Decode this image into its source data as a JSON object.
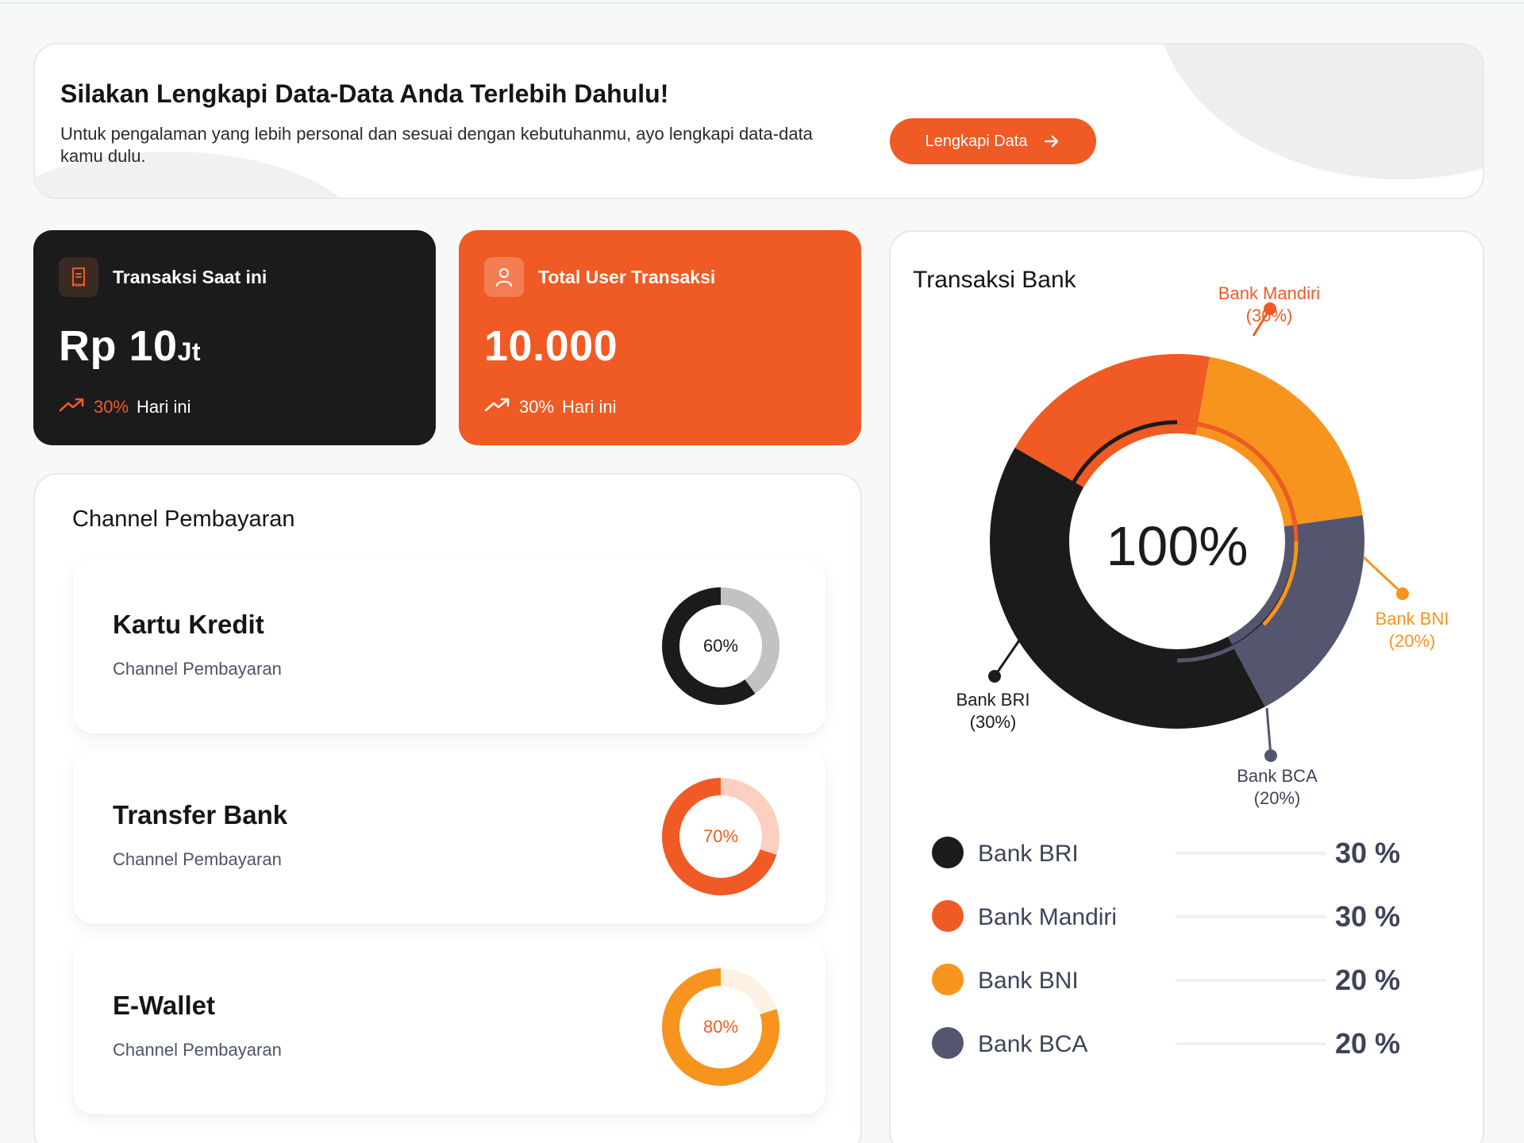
{
  "banner": {
    "title": "Silakan Lengkapi Data-Data Anda Terlebih Dahulu!",
    "text": "Untuk pengalaman yang lebih personal dan sesuai dengan kebutuhanmu, ayo lengkapi data-data kamu dulu.",
    "cta_label": "Lengkapi Data",
    "cta_icon": "arrow-right-icon"
  },
  "stats": {
    "current": {
      "icon": "receipt-icon",
      "label": "Transaksi Saat ini",
      "value": "Rp 10",
      "unit": "Jt",
      "trend_pct": "30%",
      "trend_label": "Hari ini"
    },
    "users": {
      "icon": "user-icon",
      "label": "Total User Transaksi",
      "value": "10.000",
      "trend_pct": "30%",
      "trend_label": "Hari ini"
    }
  },
  "channel": {
    "title": "Channel Pembayaran",
    "items": [
      {
        "name": "Kartu Kredit",
        "sub": "Channel Pembayaran",
        "pct_label": "60%",
        "pct": 60,
        "color": "#1b1b1b",
        "track": "#c2c2c2",
        "text_color": "#1b1b1b"
      },
      {
        "name": "Transfer Bank",
        "sub": "Channel Pembayaran",
        "pct_label": "70%",
        "pct": 70,
        "color": "#f05a24",
        "track": "#fbd0c0",
        "text_color": "#f05a24"
      },
      {
        "name": "E-Wallet",
        "sub": "Channel Pembayaran",
        "pct_label": "80%",
        "pct": 80,
        "color": "#f7941e",
        "track": "#fdf1e3",
        "text_color": "#f05a24"
      }
    ]
  },
  "bank": {
    "title": "Transaksi Bank",
    "center_label": "100%",
    "callouts": {
      "mandiri": {
        "name": "Bank Mandiri",
        "pct": "(30%)"
      },
      "bni": {
        "name": "Bank BNI",
        "pct": "(20%)"
      },
      "bri": {
        "name": "Bank BRI",
        "pct": "(30%)"
      },
      "bca": {
        "name": "Bank BCA",
        "pct": "(20%)"
      }
    },
    "legend": [
      {
        "name": "Bank BRI",
        "value": "30 %",
        "color": "#1b1b1b"
      },
      {
        "name": "Bank Mandiri",
        "value": "30 %",
        "color": "#f05a24"
      },
      {
        "name": "Bank BNI",
        "value": "20 %",
        "color": "#f7941e"
      },
      {
        "name": "Bank BCA",
        "value": "20 %",
        "color": "#545670"
      }
    ]
  },
  "colors": {
    "accent": "#f05a24",
    "dark": "#1b1b1b",
    "amber": "#f7941e",
    "slate": "#545670"
  }
}
